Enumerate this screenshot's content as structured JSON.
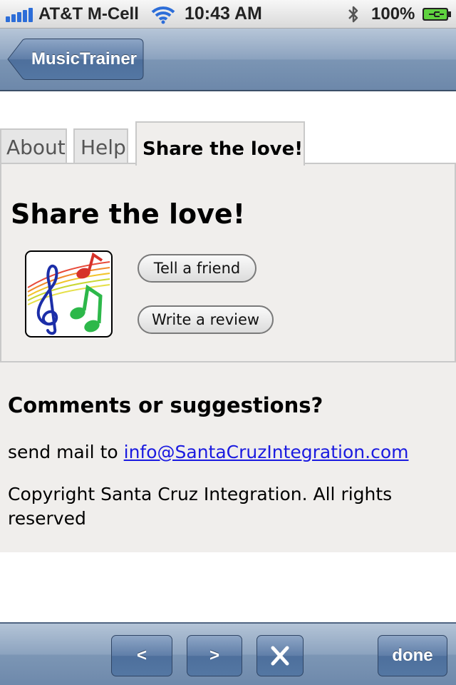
{
  "status_bar": {
    "carrier": "AT&T M-Cell",
    "time": "10:43 AM",
    "battery_percent": "100%",
    "signal_bars": 5
  },
  "nav_bar": {
    "back_label": "MusicTrainer"
  },
  "tabs": [
    {
      "label": "About",
      "active": false
    },
    {
      "label": "Help",
      "active": false
    },
    {
      "label": "Share the love!",
      "active": true
    }
  ],
  "share": {
    "heading": "Share the love!",
    "icon": "music-notes-icon",
    "tell_friend_label": "Tell a friend",
    "write_review_label": "Write a review"
  },
  "comments": {
    "heading": "Comments or suggestions?",
    "mail_prefix": "send mail to",
    "email": "info@SantaCruzIntegration.com",
    "copyright": "Copyright Santa Cruz Integration. All rights reserved"
  },
  "toolbar": {
    "prev_label": "<",
    "next_label": ">",
    "close_icon": "close-x-icon",
    "done_label": "done"
  },
  "colors": {
    "link": "#1a1ae0",
    "bar_blue": "#6d88aa",
    "panel_bg": "#f0eeec"
  }
}
